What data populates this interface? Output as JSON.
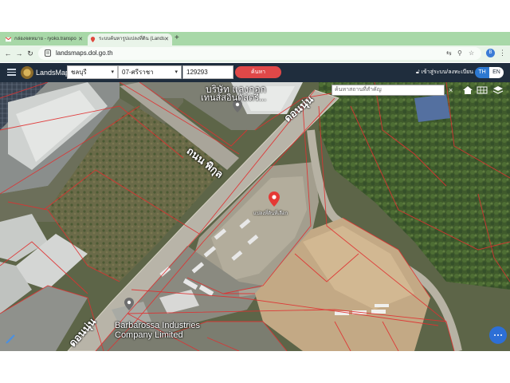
{
  "browser": {
    "tabs": [
      {
        "title": "กล่องจดหมาย - ryoko.transpo",
        "active": false
      },
      {
        "title": "ระบบค้นหารูปแปลงที่ดิน (Lands",
        "active": true
      }
    ],
    "new_tab": "+",
    "url": "landsmaps.dol.go.th",
    "profile_initial": "B"
  },
  "app": {
    "brand": "LandsMaps",
    "province": "ชลบุรี",
    "district": "07-ศรีราชา",
    "parcel_number": "129293",
    "search_label": "ค้นหา",
    "login_label": "เข้าสู่ระบบ/ลงทะเบียน",
    "lang_th": "TH",
    "lang_en": "EN"
  },
  "map": {
    "place_search_placeholder": "ค้นหาสถานที่สำคัญ",
    "close_symbol": "×",
    "labels": {
      "road_top": "ถนน พิกุล",
      "road_diag": "ดอนนุ่น",
      "road_bottom": "ดอนนุ่น",
      "company_top": "บริษัท แลงกอก",
      "company_top2": "เทนส์สอินดัสตรี...",
      "pin_label": "แปลงที่ดินที่เลือก",
      "company_bottom_1": "Barbarossa Industries",
      "company_bottom_2": "Company Limited"
    }
  },
  "colors": {
    "header_bg": "#1f2d3d",
    "search_button": "#e04848",
    "accent_blue": "#2d78d0",
    "parcel_lines": "#e03030",
    "tabbar": "#a8d8a8"
  }
}
